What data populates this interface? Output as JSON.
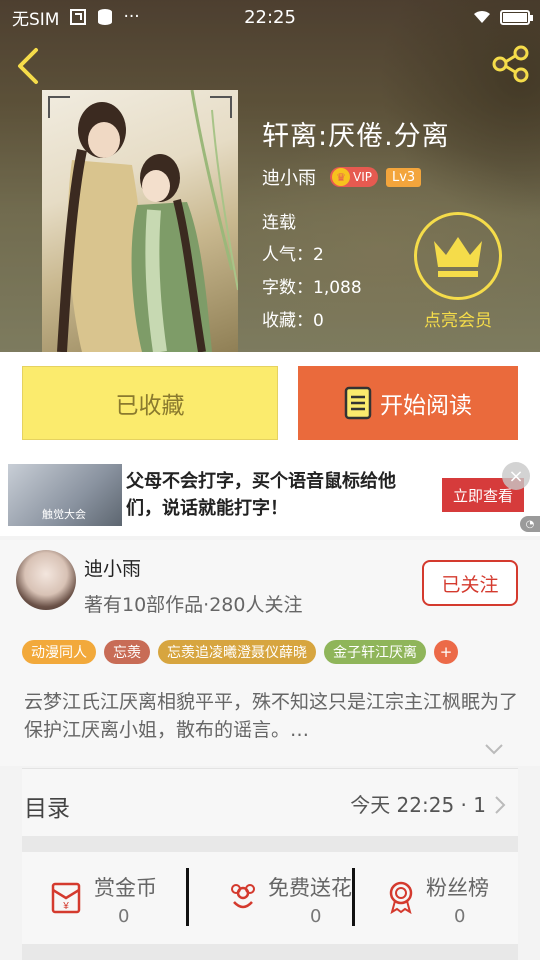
{
  "status_bar": {
    "carrier": "无SIM",
    "time": "22:25",
    "dots": "···"
  },
  "book": {
    "title": "轩离:厌倦.分离",
    "author": "迪小雨",
    "vip_label": "VIP",
    "level": "Lv3",
    "status": "连载",
    "popularity": "人气：2",
    "word_count": "字数：1,088",
    "favorites": "收藏：0",
    "member_label": "点亮会员"
  },
  "actions": {
    "favorited_label": "已收藏",
    "read_label": "开始阅读"
  },
  "ad": {
    "text": "父母不会打字，买个语音鼠标给他们，说话就能打字！",
    "button": "立即查看",
    "image_caption": "触觉大会",
    "close": "×"
  },
  "author_section": {
    "name": "迪小雨",
    "info": "著有10部作品·280人关注",
    "follow_label": "已关注",
    "tags": [
      {
        "label": "动漫同人",
        "color": "#f2a93b"
      },
      {
        "label": "忘羡",
        "color": "#c86c56"
      },
      {
        "label": "忘羡追凌曦澄聂仪薛晓",
        "color": "#d7a53f"
      },
      {
        "label": "金子轩江厌离",
        "color": "#8fb55a"
      }
    ],
    "tag_more": "+",
    "description": "云梦江氏江厌离相貌平平，殊不知这只是江宗主江枫眠为了保护江厌离小姐，散布的谣言。…"
  },
  "catalog": {
    "title": "目录",
    "update": "今天 22:25 · 1"
  },
  "stats": [
    {
      "label": "赏金币",
      "value": "0",
      "icon": "red-envelope-icon"
    },
    {
      "label": "免费送花",
      "value": "0",
      "icon": "flower-icon"
    },
    {
      "label": "粉丝榜",
      "value": "0",
      "icon": "medal-icon"
    }
  ],
  "colors": {
    "accent": "#ea6a3c",
    "favorite": "#fbeb6d",
    "follow": "#d43a2e",
    "vip_gold": "#f5dc4a"
  }
}
